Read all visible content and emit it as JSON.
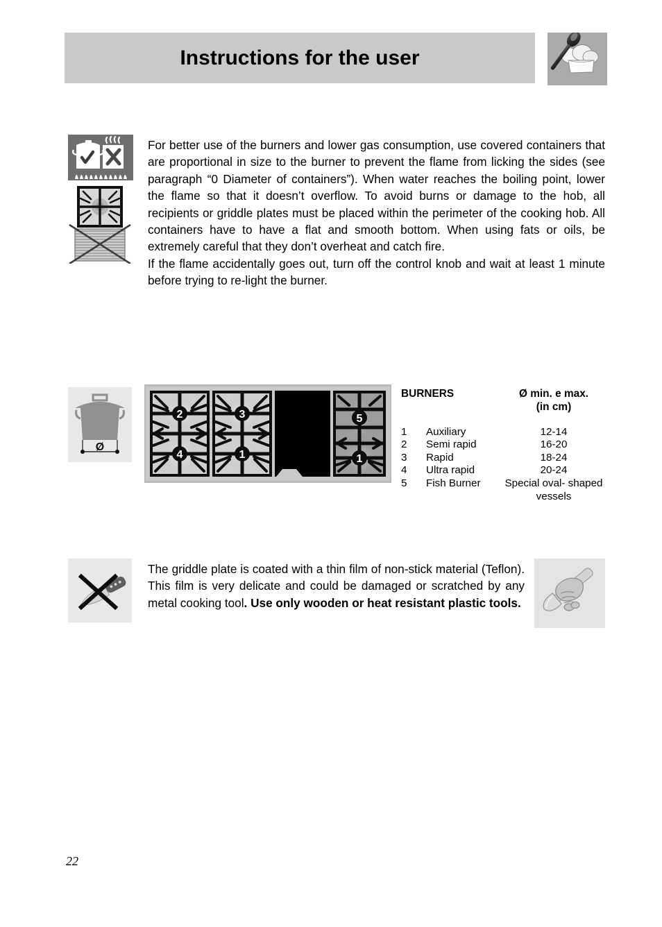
{
  "header": {
    "title": "Instructions for the user",
    "icon": "chef-hat-spoon-icon"
  },
  "section_burners": {
    "icons": [
      "covered-pot-check-uncovered-pot-cross-icon",
      "grate-no-overhang-cross-icon"
    ],
    "paragraph_1": "For better use of the burners and lower gas consumption, use covered containers that are proportional in size to the burner to prevent the flame from licking the sides (see paragraph “0 Diameter of containers”). When water reaches the boiling point, lower the flame so that it doesn’t overflow. To avoid burns or damage to the hob, all recipients or griddle plates must be placed within the perimeter of the cooking hob. All containers have to have a flat and smooth bottom. When using fats or oils, be extremely careful that they don’t overheat and catch fire.",
    "paragraph_2": "If the flame accidentally goes out, turn off the control knob and wait at least 1 minute before trying to re-light the burner."
  },
  "section_table": {
    "pot_icon": "pot-diameter-icon",
    "pot_icon_label": "Ø",
    "hob_diagram": {
      "name": "cooking-hob-burner-layout-diagram",
      "panels": [
        {
          "type": "grate",
          "shade": "light",
          "burners": [
            "2",
            "4"
          ]
        },
        {
          "type": "grate",
          "shade": "light",
          "burners": [
            "3",
            "1"
          ]
        },
        {
          "type": "griddle",
          "shade": "black",
          "burners": []
        },
        {
          "type": "grate",
          "shade": "dark",
          "burners": [
            "5",
            "1"
          ]
        }
      ]
    },
    "headers": {
      "col_burners": "BURNERS",
      "col_diameter_line1": "Ø min. e max.",
      "col_diameter_line2": "(in cm)"
    },
    "rows": [
      {
        "num": "1",
        "name": "Auxiliary",
        "size": "12-14"
      },
      {
        "num": "2",
        "name": "Semi rapid",
        "size": "16-20"
      },
      {
        "num": "3",
        "name": "Rapid",
        "size": "18-24"
      },
      {
        "num": "4",
        "name": "Ultra rapid",
        "size": "20-24"
      },
      {
        "num": "5",
        "name": "Fish Burner",
        "size": "Special oval-\nshaped vessels"
      }
    ]
  },
  "section_teflon": {
    "icon_left": "no-metal-knife-icon",
    "icon_right": "hand-holding-spatula-icon",
    "text_normal": "The griddle plate is coated with a thin film of non-stick material (Teflon). This film is very delicate and could be damaged or scratched by any metal cooking tool",
    "text_bold": ". Use only wooden or heat resistant plastic tools."
  },
  "footer": {
    "page_number": "22"
  },
  "colors": {
    "header_banner": "#c9c9c9",
    "header_icon_bg": "#ababab",
    "icon_dark_bg": "#6e6e6e",
    "icon_light_bg": "#e8e8e8",
    "text": "#000000"
  }
}
